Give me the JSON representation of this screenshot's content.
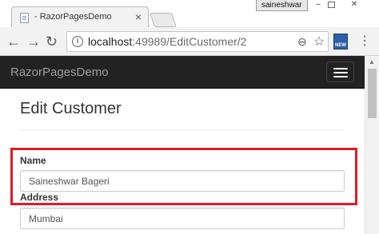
{
  "browser": {
    "tab_title": "- RazorPagesDemo",
    "tab_close": "×",
    "user": "saineshwar",
    "win_min": "–",
    "win_close": "✕",
    "url_host": "localhost",
    "url_rest": ":49989/EditCustomer/2",
    "icons": {
      "back": "←",
      "forward": "→",
      "reload": "↻",
      "info": "i",
      "zoom": "⊖",
      "star": "☆",
      "menu": "⋮"
    }
  },
  "navbar": {
    "brand": "RazorPagesDemo"
  },
  "main": {
    "title": "Edit Customer",
    "fields": {
      "name_label": "Name",
      "name_value": "Saineshwar Bageri",
      "address_label": "Address",
      "address_value": "Mumbai"
    }
  },
  "colors": {
    "navbar_bg": "#222222",
    "highlight": "#e01b24"
  }
}
